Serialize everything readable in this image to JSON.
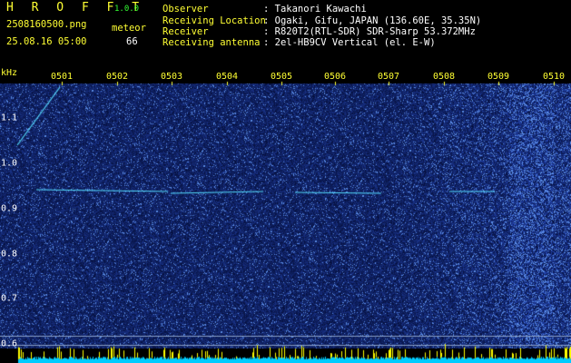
{
  "header": {
    "brand": "H R O F F T",
    "version": "1.0.0",
    "filename": "2508160500.png",
    "datetime": "25.08.16 05:00",
    "meteor_label": "meteor",
    "meteor_count": "66"
  },
  "station": {
    "labels": [
      "Observer",
      "Receiving Location",
      "Receiver",
      "Receiving antenna"
    ],
    "values": [
      ": Takanori Kawachi",
      ": Ogaki, Gifu, JAPAN (136.60E, 35.35N)",
      ": R820T2(RTL-SDR) SDR-Sharp 53.372MHz",
      ": 2el-HB9CV Vertical (el. E-W)"
    ]
  },
  "axis": {
    "unit": "kHz",
    "time_ticks": [
      "0501",
      "0502",
      "0503",
      "0504",
      "0505",
      "0506",
      "0507",
      "0508",
      "0509",
      "0510"
    ],
    "freq_ticks": [
      "1.1",
      "1.0",
      "0.9",
      "0.8",
      "0.7",
      "0.6"
    ]
  },
  "colors": {
    "background": "#000000",
    "label_yellow": "#ffff33",
    "label_green": "#33ff33",
    "signal_cyan": "#55ddff",
    "waterfall_base": "#0a1c5a"
  }
}
